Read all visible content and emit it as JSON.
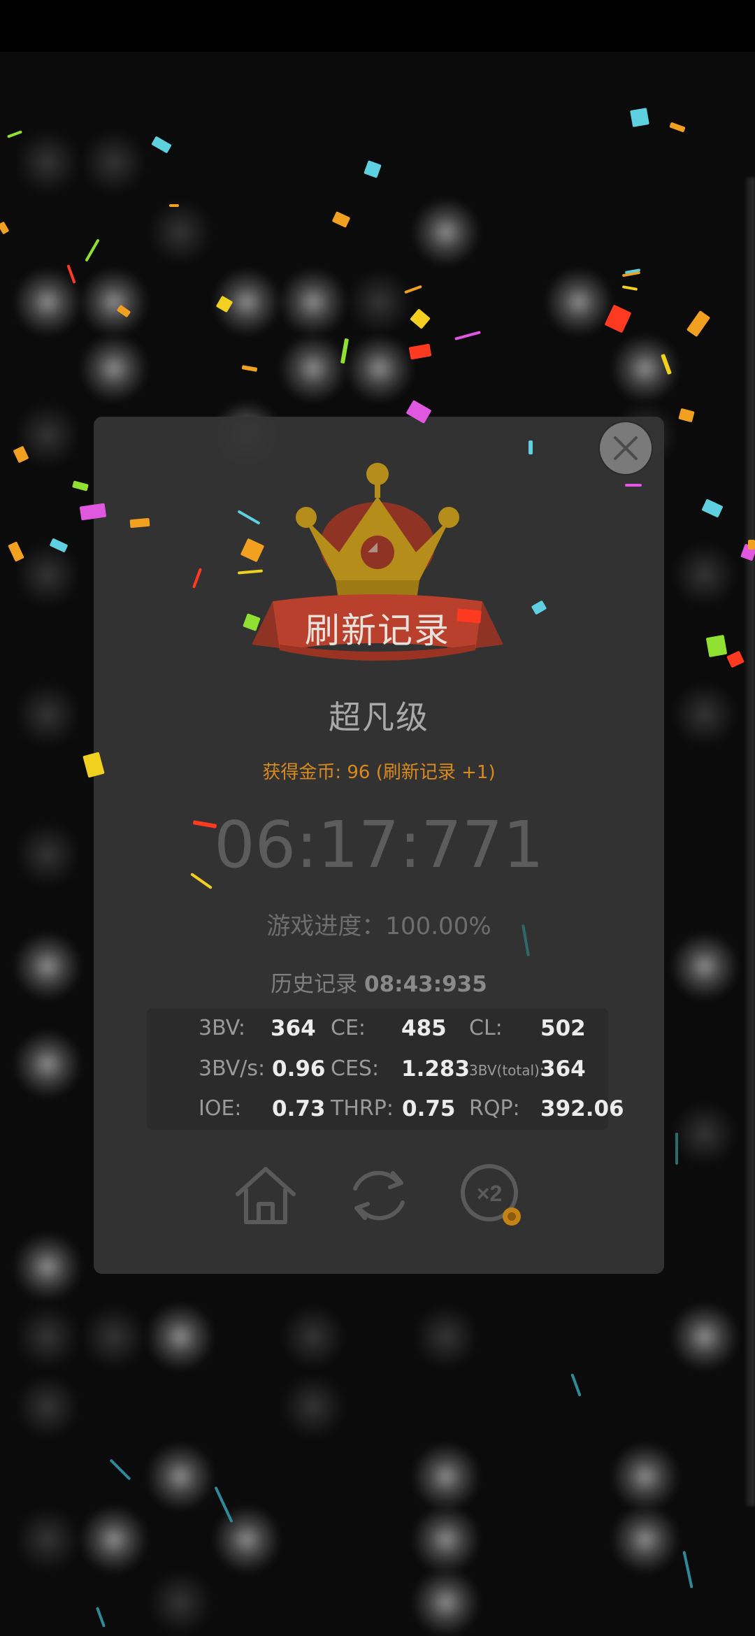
{
  "result": {
    "banner": "刷新记录",
    "rank_title": "超凡级",
    "coins_line": "获得金币: 96 (刷新记录 +1)",
    "time": "06:17:771",
    "progress": "游戏进度：100.00%",
    "history_label": "历史记录",
    "history_value": "08:43:935"
  },
  "stats": [
    {
      "label": "3BV:",
      "value": "364"
    },
    {
      "label": "CE:",
      "value": "485"
    },
    {
      "label": "CL:",
      "value": "502"
    },
    {
      "label": "3BV/s:",
      "value": "0.96"
    },
    {
      "label": "CES:",
      "value": "1.283"
    },
    {
      "label": "3BV(total):",
      "value": "364"
    },
    {
      "label": "IOE:",
      "value": "0.73"
    },
    {
      "label": "THRP:",
      "value": "0.75"
    },
    {
      "label": "RQP:",
      "value": "392.06"
    }
  ],
  "actions": [
    {
      "icon": "home-icon"
    },
    {
      "icon": "replay-icon"
    },
    {
      "icon": "double-coins-icon"
    }
  ],
  "colors": {
    "accent_orange": "#d98a1e",
    "crown_gold": "#c49a1c",
    "ribbon_red": "#b8402c",
    "modal_bg": "#343434",
    "stats_bg": "#2b2b2b"
  }
}
